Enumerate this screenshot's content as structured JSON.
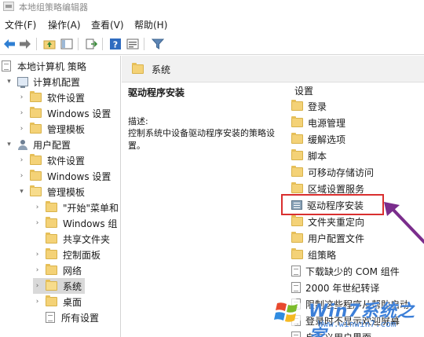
{
  "window": {
    "title": "本地组策略编辑器"
  },
  "menu": {
    "items": [
      "文件(F)",
      "操作(A)",
      "查看(V)",
      "帮助(H)"
    ]
  },
  "toolbar": {
    "icons": [
      "back-arrow-icon",
      "forward-arrow-icon",
      "up-folder-icon",
      "show-hide-tree-icon",
      "export-list-icon",
      "help-icon",
      "properties-icon",
      "filter-icon"
    ]
  },
  "tree": {
    "items": [
      {
        "label": "本地计算机 策略",
        "expander": "",
        "icon": "doc"
      },
      {
        "label": "计算机配置",
        "expander": "▾",
        "icon": "pc"
      },
      {
        "label": "软件设置",
        "expander": "›",
        "icon": "folder"
      },
      {
        "label": "Windows 设置",
        "expander": "›",
        "icon": "folder"
      },
      {
        "label": "管理模板",
        "expander": "›",
        "icon": "folder"
      },
      {
        "label": "用户配置",
        "expander": "▾",
        "icon": "user"
      },
      {
        "label": "软件设置",
        "expander": "›",
        "icon": "folder"
      },
      {
        "label": "Windows 设置",
        "expander": "›",
        "icon": "folder"
      },
      {
        "label": "管理模板",
        "expander": "▾",
        "icon": "folder-open"
      },
      {
        "label": "\"开始\"菜单和",
        "expander": "›",
        "icon": "folder"
      },
      {
        "label": "Windows 组",
        "expander": "›",
        "icon": "folder"
      },
      {
        "label": "共享文件夹",
        "expander": "",
        "icon": "folder"
      },
      {
        "label": "控制面板",
        "expander": "›",
        "icon": "folder"
      },
      {
        "label": "网络",
        "expander": "›",
        "icon": "folder"
      },
      {
        "label": "系统",
        "expander": "›",
        "icon": "folder-open"
      },
      {
        "label": "桌面",
        "expander": "›",
        "icon": "folder"
      },
      {
        "label": "所有设置",
        "expander": "",
        "icon": "doc"
      }
    ]
  },
  "breadcrumb": {
    "text": "系统"
  },
  "detail": {
    "title": "驱动程序安装",
    "label": "描述:",
    "text": "控制系统中设备驱动程序安装的策略设置。"
  },
  "list": {
    "header": "设置",
    "items": [
      {
        "label": "登录",
        "icon": "folder"
      },
      {
        "label": "电源管理",
        "icon": "folder"
      },
      {
        "label": "缓解选项",
        "icon": "folder"
      },
      {
        "label": "脚本",
        "icon": "folder"
      },
      {
        "label": "可移动存储访问",
        "icon": "folder"
      },
      {
        "label": "区域设置服务",
        "icon": "folder"
      },
      {
        "label": "驱动程序安装",
        "icon": "setting"
      },
      {
        "label": "文件夹重定向",
        "icon": "folder"
      },
      {
        "label": "用户配置文件",
        "icon": "folder"
      },
      {
        "label": "组策略",
        "icon": "folder"
      },
      {
        "label": "下载缺少的 COM 组件",
        "icon": "doc"
      },
      {
        "label": "2000 年世纪转译",
        "icon": "doc"
      },
      {
        "label": "限制这些程序从帮助启动",
        "icon": "doc"
      },
      {
        "label": "登录时不显示欢迎屏幕",
        "icon": "doc"
      },
      {
        "label": "自定义用户界面",
        "icon": "doc"
      }
    ]
  },
  "watermark": {
    "text": "Win7系统之家",
    "url": "Www.winwin7.com"
  },
  "colors": {
    "highlight": "#d92f2f",
    "arrow": "#7a2d8c",
    "folder": "#f4d277"
  }
}
